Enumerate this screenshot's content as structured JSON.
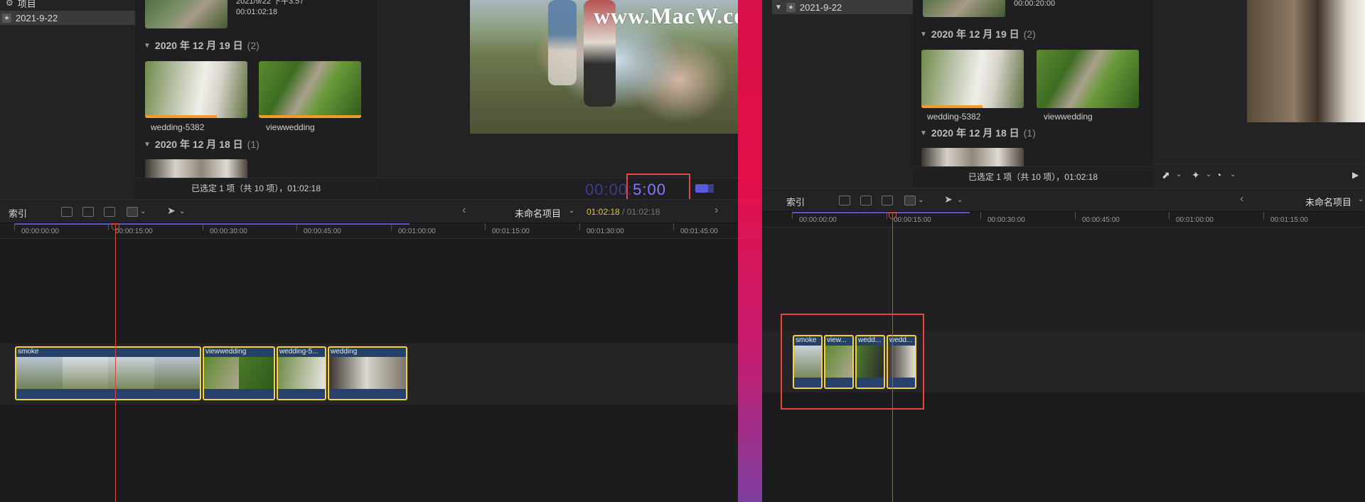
{
  "watermark": "www.MacW.com",
  "left": {
    "sidebar": {
      "items": [
        {
          "label": "项目",
          "icon": "gear-icon"
        },
        {
          "label": "2021-9-22",
          "icon": "star-icon",
          "selected": true
        }
      ]
    },
    "browser": {
      "top_clip_meta": [
        "2021/9/22 下午3:57",
        "00:01:02:18"
      ],
      "groups": [
        {
          "date": "2020 年 12 月 19 日",
          "count": "(2)",
          "clips": [
            "wedding-5382",
            "viewwedding"
          ]
        },
        {
          "date": "2020 年 12 月 18 日",
          "count": "(1)",
          "clips": []
        }
      ],
      "status": "已选定 1 项（共 10 项），01:02:18"
    },
    "viewer": {
      "timecode_dim": "00:00:",
      "timecode_bright": "5:00"
    },
    "toolbar": {
      "index_label": "索引",
      "project_name": "未命名项目",
      "project_time_current": "01:02:18",
      "project_time_sep": " / ",
      "project_time_total": "01:02:18"
    },
    "ruler": [
      "00:00:00:00",
      "00:00:15:00",
      "00:00:30:00",
      "00:00:45:00",
      "00:01:00:00",
      "00:01:15:00",
      "00:01:30:00",
      "00:01:45:00"
    ],
    "clips": [
      "smoke",
      "viewwedding",
      "wedding-5...",
      "wedding"
    ]
  },
  "right": {
    "sidebar": {
      "items": [
        {
          "label": "2021-9-22",
          "icon": "star-icon",
          "selected": true
        }
      ]
    },
    "browser": {
      "top_clip_meta": [
        "00:00:20:00"
      ],
      "groups": [
        {
          "date": "2020 年 12 月 19 日",
          "count": "(2)",
          "clips": [
            "wedding-5382",
            "viewwedding"
          ]
        },
        {
          "date": "2020 年 12 月 18 日",
          "count": "(1)",
          "clips": []
        }
      ],
      "status": "已选定 1 项（共 10 项），01:02:18"
    },
    "toolbar": {
      "index_label": "索引",
      "project_name": "未命名项目"
    },
    "ruler": [
      "00:00:00:00",
      "00:00:15:00",
      "00:00:30:00",
      "00:00:45:00",
      "00:01:00:00",
      "00:01:15:00"
    ],
    "clips": [
      "smoke",
      "view...",
      "wedd...",
      "wedd..."
    ]
  },
  "colors": {
    "accent_timecode": "#7f7dff",
    "selection_border": "#f2d33c",
    "playhead": "#d7483a",
    "highlight_box": "#e5473a",
    "project_time": "#e0c63a",
    "divider_top": "#e4104a",
    "divider_bottom": "#7e3fa0"
  }
}
